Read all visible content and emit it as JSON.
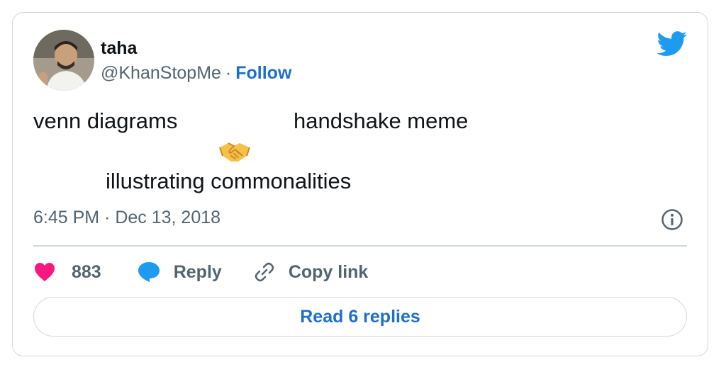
{
  "author": {
    "name": "taha",
    "handle": "@KhanStopMe",
    "separator": "·",
    "follow_label": "Follow"
  },
  "tweet": {
    "line1_left": "venn diagrams",
    "line1_right": "handshake meme",
    "emoji": "handshake",
    "line3": "illustrating commonalities"
  },
  "timestamp": "6:45 PM · Dec 13, 2018",
  "actions": {
    "like_count": "883",
    "reply_label": "Reply",
    "copy_label": "Copy link"
  },
  "read_replies_label": "Read 6 replies",
  "colors": {
    "accent": "#1d6fce",
    "twitter_blue": "#1d9bf0",
    "like_pink": "#f91880",
    "text": "#0f1419",
    "muted": "#536471",
    "border": "#cfd9de"
  },
  "icons": [
    "twitter-bird-icon",
    "handshake-icon",
    "info-icon",
    "heart-icon",
    "reply-bubble-icon",
    "link-icon"
  ]
}
